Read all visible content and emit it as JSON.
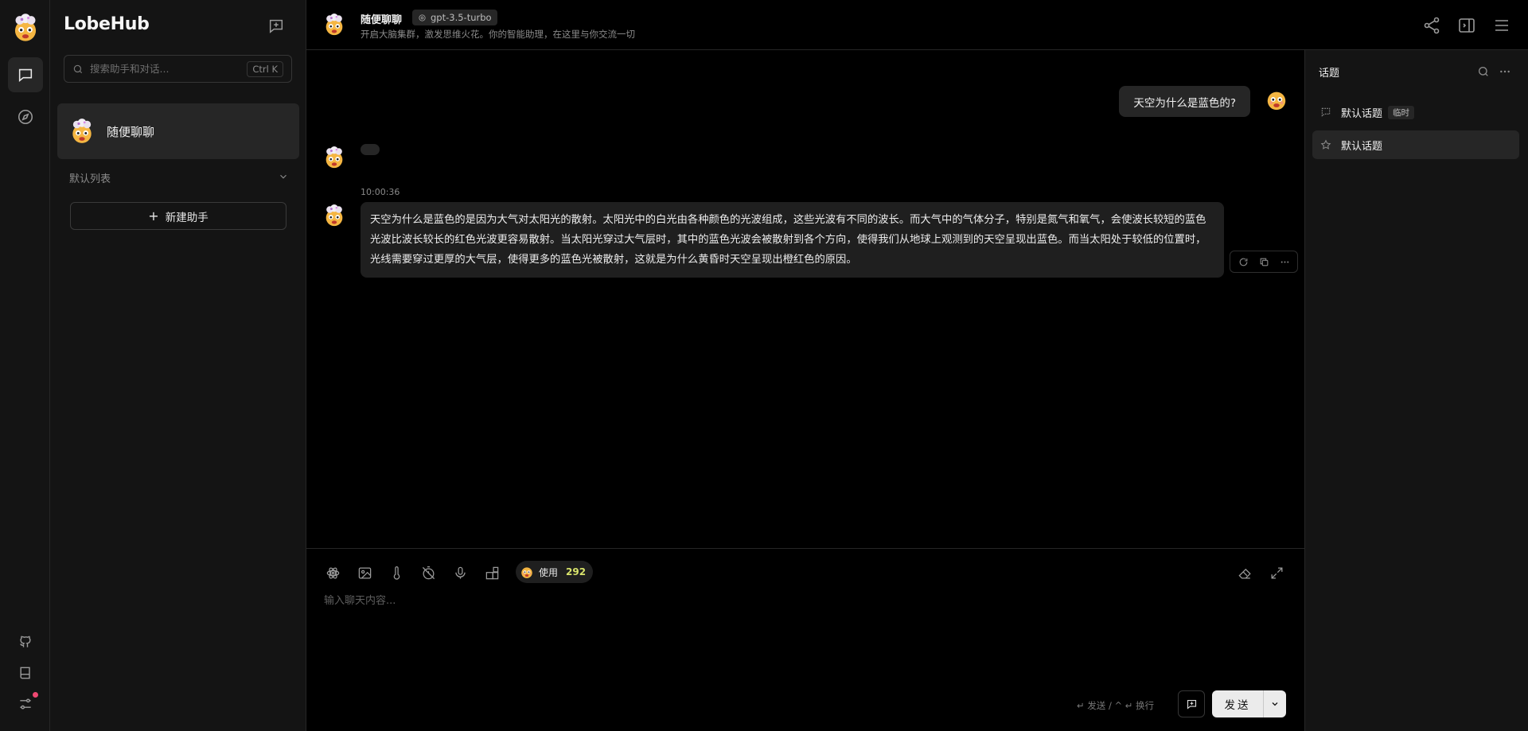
{
  "app": {
    "brand": "LobeHub"
  },
  "colors": {
    "bg": "#000000",
    "panel": "#141414",
    "active": "#262626",
    "accent_dot": "#ef4872",
    "token_count": "#d8e36b"
  },
  "rail": {
    "items": [
      {
        "name": "chat-icon",
        "active": true
      },
      {
        "name": "discover-icon",
        "active": false
      }
    ],
    "bottom": [
      "github-icon",
      "docs-icon",
      "settings-icon"
    ]
  },
  "sidebar": {
    "search": {
      "placeholder": "搜索助手和对话...",
      "shortcut": "Ctrl K"
    },
    "session": {
      "name": "随便聊聊"
    },
    "group": {
      "label": "默认列表"
    },
    "new_assistant": {
      "plus": "+",
      "label": "新建助手"
    }
  },
  "header": {
    "title": "随便聊聊",
    "model": "gpt-3.5-turbo",
    "description": "开启大脑集群，激发思维火花。你的智能助理，在这里与你交流一切"
  },
  "chat": {
    "user_message": "天空为什么是蓝色的?",
    "timestamp": "10:00:36",
    "assistant_message": "天空为什么是蓝色的是因为大气对太阳光的散射。太阳光中的白光由各种颜色的光波组成，这些光波有不同的波长。而大气中的气体分子，特别是氮气和氧气，会使波长较短的蓝色光波比波长较长的红色光波更容易散射。当太阳光穿过大气层时，其中的蓝色光波会被散射到各个方向，使得我们从地球上观测到的天空呈现出蓝色。而当太阳处于较低的位置时，光线需要穿过更厚的大气层，使得更多的蓝色光被散射，这就是为什么黄昏时天空呈现出橙红色的原因。"
  },
  "composer": {
    "tokens_label": "使用",
    "tokens_count": "292",
    "placeholder": "输入聊天内容...",
    "hint": "↵ 发送 / ^ ↵ 换行",
    "send_label": "发送"
  },
  "topics": {
    "title": "话题",
    "items": [
      {
        "label": "默认话题",
        "tag": "临时"
      },
      {
        "label": "默认话题"
      }
    ]
  }
}
